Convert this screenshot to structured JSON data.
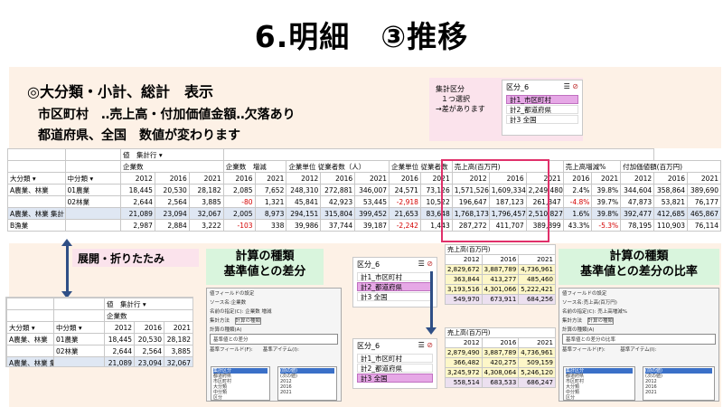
{
  "title": "6.明細　③推移",
  "heading": "◎大分類・小計、総計　表示",
  "line1": "市区町村　‥売上高・付加価値金額‥欠落あり",
  "line2": "都道府県、全国　数値が変わります",
  "note": {
    "l1": "集計区分",
    "l2": "１つ選択",
    "l3": "→差があります"
  },
  "slicer_top": {
    "title": "区分_6",
    "items": [
      "計1_市区町村",
      "計2_都道府県",
      "計3 全国"
    ]
  },
  "slicer_mid": {
    "title": "区分_6",
    "items": [
      "計1_市区町村",
      "計2_都道府県",
      "計3 全国"
    ]
  },
  "slicer_bot": {
    "title": "区分_6",
    "items": [
      "計1_市区町村",
      "計2_都道府県",
      "計3 全国"
    ]
  },
  "pivot": {
    "values_label": "値",
    "agg_label": "集計行",
    "groups": [
      "企業数",
      "企業数　増減",
      "企業単位 従業者数（人）",
      "企業単位 従業者数",
      "売上高(百万円)",
      "売上高増減%",
      "付加価値額(百万円)"
    ],
    "row_h1": "大分類",
    "row_h2": "中分類",
    "years": [
      "2012",
      "2016",
      "2021",
      "2016",
      "2021",
      "2012",
      "2016",
      "2021",
      "2016",
      "2021",
      "2012",
      "2016",
      "2021",
      "2016",
      "2021",
      "2012",
      "2016",
      "2021"
    ],
    "rows": [
      {
        "c1": "A農業、林業",
        "c2": "01農業",
        "v": [
          "18,445",
          "20,530",
          "28,182",
          "2,085",
          "7,652",
          "248,310",
          "272,881",
          "346,007",
          "24,571",
          "73,126",
          "1,571,526",
          "1,609,334",
          "2,249,480",
          "2.4%",
          "39.8%",
          "344,604",
          "358,864",
          "389,690"
        ]
      },
      {
        "c1": "",
        "c2": "02林業",
        "v": [
          "2,644",
          "2,564",
          "3,885",
          "-80",
          "1,321",
          "45,841",
          "42,923",
          "53,445",
          "-2,918",
          "10,522",
          "196,647",
          "187,123",
          "261,347",
          "-4.8%",
          "39.7%",
          "47,873",
          "53,821",
          "76,177"
        ]
      },
      {
        "c1": "A農業、林業 集計",
        "c2": "",
        "v": [
          "21,089",
          "23,094",
          "32,067",
          "2,005",
          "8,973",
          "294,151",
          "315,804",
          "399,452",
          "21,653",
          "83,648",
          "1,768,173",
          "1,796,457",
          "2,510,827",
          "1.6%",
          "39.8%",
          "392,477",
          "412,685",
          "465,867"
        ]
      },
      {
        "c1": "B漁業",
        "c2": "",
        "v": [
          "2,987",
          "2,884",
          "3,222",
          "-103",
          "338",
          "39,986",
          "37,744",
          "39,187",
          "-2,242",
          "1,443",
          "287,272",
          "411,707",
          "389,899",
          "43.3%",
          "-5.3%",
          "78,195",
          "110,903",
          "76,114"
        ]
      }
    ]
  },
  "expand_label": "展開・折りたたみ",
  "mini_pivot": {
    "values_label": "値",
    "agg_label": "集計行",
    "group": "企業数",
    "row_h1": "大分類",
    "row_h2": "中分類",
    "years": [
      "2012",
      "2016",
      "2021"
    ],
    "rows": [
      {
        "c1": "A農業、林業",
        "c2": "01農業",
        "v": [
          "18,445",
          "20,530",
          "28,182"
        ]
      },
      {
        "c1": "",
        "c2": "02林業",
        "v": [
          "2,644",
          "2,564",
          "3,885"
        ]
      },
      {
        "c1": "A農業、林業 集計",
        "c2": "",
        "v": [
          "21,089",
          "23,094",
          "32,067"
        ]
      }
    ]
  },
  "calc_left": {
    "l1": "計算の種類",
    "l2": "基準値との差分"
  },
  "calc_right": {
    "l1": "計算の種類",
    "l2": "基準値との差分の比率"
  },
  "mini_sales_top": {
    "header": "売上高(百万円)",
    "years": [
      "2012",
      "2016",
      "2021"
    ],
    "rows": [
      [
        "2,829,672",
        "3,887,789",
        "4,736,961"
      ],
      [
        "363,844",
        "413,277",
        "485,460"
      ],
      [
        "3,193,516",
        "4,301,066",
        "5,222,421"
      ]
    ],
    "total": [
      "549,970",
      "673,911",
      "684,256"
    ]
  },
  "mini_sales_bot": {
    "header": "売上高(百万円)",
    "years": [
      "2012",
      "2016",
      "2021"
    ],
    "rows": [
      [
        "2,879,490",
        "3,887,789",
        "4,736,961"
      ],
      [
        "366,482",
        "420,275",
        "509,159"
      ],
      [
        "3,245,972",
        "4,308,064",
        "5,246,120"
      ]
    ],
    "total": [
      "558,514",
      "683,533",
      "686,247"
    ]
  },
  "dialog_left": {
    "title": "値フィールドの設定",
    "source": "ソース名:企業数",
    "name": "名前の指定(C): 企業数 増減",
    "tab1": "集計方法",
    "tab2": "計算の種類",
    "calc": "計算の種類(A)",
    "calc_val": "基準値との差分",
    "base_field": "基準フィールド(F):",
    "base_item": "基準アイテム(I):",
    "fields": [
      "集計区分",
      "都道府県",
      "市区町村",
      "大分類",
      "中分類",
      "区分"
    ],
    "items": [
      "(前の値)",
      "(次の値)",
      "2012",
      "2016",
      "2021"
    ]
  },
  "dialog_right": {
    "title": "値フィールドの設定",
    "source": "ソース名:売上高(百万円)",
    "name": "名前の指定(C): 売上高増減%",
    "tab1": "集計方法",
    "tab2": "計算の種類",
    "calc": "計算の種類(A)",
    "calc_val": "基準値との差分の比率",
    "base_field": "基準フィールド(F):",
    "base_item": "基準アイテム(I):",
    "fields": [
      "集計区分",
      "都道府県",
      "市区町村",
      "大分類",
      "中分類",
      "区分"
    ],
    "items": [
      "(前の値)",
      "(次の値)",
      "2012",
      "2016",
      "2021"
    ]
  }
}
